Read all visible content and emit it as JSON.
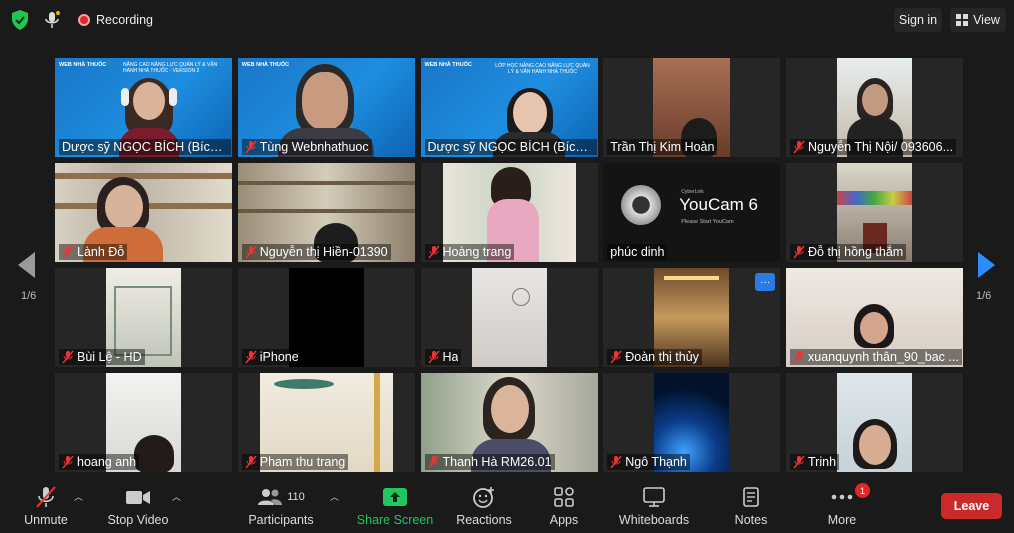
{
  "topbar": {
    "recording_label": "Recording",
    "sign_in_label": "Sign in",
    "view_label": "View"
  },
  "pagination": {
    "left": "1/6",
    "right": "1/6"
  },
  "participants": [
    {
      "name": "Dược sỹ NGỌC BÍCH (Bích ...",
      "muted": false
    },
    {
      "name": "Tùng Webnhathuoc",
      "muted": true
    },
    {
      "name": "Dược sỹ NGỌC BÍCH (Bích ...",
      "muted": false,
      "active": true
    },
    {
      "name": "Trần Thị Kim Hoàn",
      "muted": false
    },
    {
      "name": "Nguyễn Thị Nội/ 093606...",
      "muted": true
    },
    {
      "name": "Lành Đỗ",
      "muted": true
    },
    {
      "name": "Nguyễn thị Hiền-01390",
      "muted": true
    },
    {
      "name": "Hoàng trang",
      "muted": true
    },
    {
      "name": "phúc dinh",
      "muted": false
    },
    {
      "name": "Đỗ thị hồng thắm",
      "muted": true
    },
    {
      "name": "Bùi Lệ - HD",
      "muted": true
    },
    {
      "name": "iPhone",
      "muted": true
    },
    {
      "name": "Ha",
      "muted": true
    },
    {
      "name": "Đoàn thị thủy",
      "muted": true
    },
    {
      "name": "xuanquynh thân_90_bac ...",
      "muted": true
    },
    {
      "name": "hoang anh",
      "muted": true
    },
    {
      "name": "Pham thu trang",
      "muted": true
    },
    {
      "name": "Thanh Hà RM26.01",
      "muted": true
    },
    {
      "name": "Ngô Thạnh",
      "muted": true
    },
    {
      "name": "Trinh",
      "muted": true
    }
  ],
  "slide": {
    "brand": "WEB NHÀ THUỐC",
    "title_1": "NÂNG CAO NĂNG LỰC QUẢN LÝ & VẬN HÀNH NHÀ THUỐC - VERSION 2",
    "title_3": "LỚP HỌC NÂNG CAO NĂNG LỰC QUẢN LÝ & VẬN HÀNH NHÀ THUỐC"
  },
  "youcam": {
    "brand": "YouCam 6",
    "sub": "Please Start YouCam",
    "maker": "CyberLink"
  },
  "tile_menu_label": "···",
  "toolbar": {
    "unmute": "Unmute",
    "stop_video": "Stop Video",
    "participants": "Participants",
    "participants_count": "110",
    "share_screen": "Share Screen",
    "reactions": "Reactions",
    "apps": "Apps",
    "whiteboards": "Whiteboards",
    "notes": "Notes",
    "more": "More",
    "more_badge": "1",
    "leave": "Leave"
  },
  "colors": {
    "accent": "#2d8cff",
    "share_green": "#22c55e",
    "leave_red": "#cc2a2a",
    "active_speaker": "#d9ef64"
  }
}
